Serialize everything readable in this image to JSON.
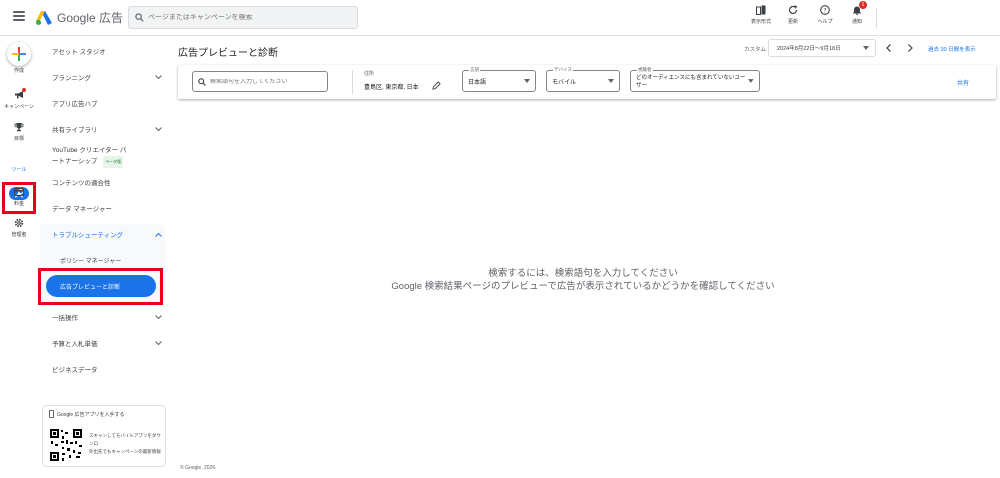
{
  "app": {
    "logo_text": "Google 広告"
  },
  "search": {
    "placeholder": "ページまたはキャンペーンを検索"
  },
  "top_actions": [
    {
      "label": "表示形式",
      "icon": "view-icon"
    },
    {
      "label": "更新",
      "icon": "refresh-icon"
    },
    {
      "label": "ヘルプ",
      "icon": "help-icon"
    },
    {
      "label": "通知",
      "icon": "bell-icon",
      "badge": "1"
    }
  ],
  "rail": {
    "create": "作成",
    "campaign": "キャンペーン",
    "goals": "目標",
    "tools": "ツール",
    "billing": "料金",
    "admin": "管理者"
  },
  "nav": {
    "asset_studio": "アセット スタジオ",
    "planning": "プランニング",
    "app_ads_hub": "アプリ広告ハブ",
    "shared_library": "共有ライブラリ",
    "youtube_creator_1": "YouTube クリエイター パ",
    "youtube_creator_2": "ートナーシップ",
    "youtube_beta": "ベータ版",
    "content_suitability": "コンテンツの適合性",
    "data_manager": "データ マネージャー",
    "troubleshooting": "トラブルシューティング",
    "policy_manager": "ポリシー マネージャー",
    "ad_preview": "広告プレビューと診断",
    "bulk_actions": "一括操作",
    "budgets_bidding": "予算と入札単価",
    "business_data": "ビジネスデータ"
  },
  "app_card": {
    "title": "Google 広告アプリを入手する",
    "desc_1": "スキャンしてモバイルアプリをダウンロ",
    "desc_2": "外出先でもキャンペーンの最新情報"
  },
  "main": {
    "title": "広告プレビューと診断",
    "date_custom": "カスタム",
    "date_range": "2024年8月22日～9月18日",
    "compare": "過去 30 日間を表示",
    "share": "共有",
    "empty_line_1": "検索するには、検索語句を入力してください",
    "empty_line_2": "Google 検索結果ページのプレビューで広告が表示されているかどうかを確認してください",
    "copyright": "© Google, 2026."
  },
  "filters": {
    "keyword_placeholder": "検索語句を入力してください",
    "location_label": "住所",
    "location_value": "豊島区, 東京都, 日本",
    "language_label": "言語",
    "language_value": "日本語",
    "device_label": "デバイス",
    "device_value": "モバイル",
    "audience_label": "視聴者",
    "audience_value": "どのオーディエンスにも含まれていないユーザー"
  },
  "colors": {
    "accent": "#1a73e8",
    "highlight": "#e8001c"
  }
}
